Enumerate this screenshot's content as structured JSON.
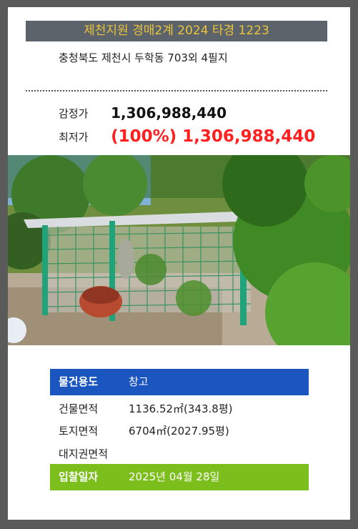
{
  "header": {
    "title": "제천지원 경매2계 2024 타경 1223"
  },
  "property": {
    "address": "충청북도 제천시 두학동 703외 4필지"
  },
  "prices": {
    "appraisal_label": "감정가",
    "appraisal_value": "1,306,988,440",
    "minimum_label": "최저가",
    "minimum_value": "(100%) 1,306,988,440"
  },
  "details": {
    "usage_label": "물건용도",
    "usage_value": "창고",
    "building_area_label": "건물면적",
    "building_area_value": "1136.52㎡(343.8평)",
    "land_area_label": "토지면적",
    "land_area_value": "6704㎡(2027.95평)",
    "land_rights_label": "대지권면적",
    "land_rights_value": "",
    "bid_date_label": "입찰일자",
    "bid_date_value": "2025년 04월 28일"
  },
  "colors": {
    "title_bg": "#5c636a",
    "title_text": "#e9c43c",
    "minimum_price": "#ff1f1f",
    "usage_row_bg": "#1b55c0",
    "bid_row_bg": "#7cbf1c"
  }
}
